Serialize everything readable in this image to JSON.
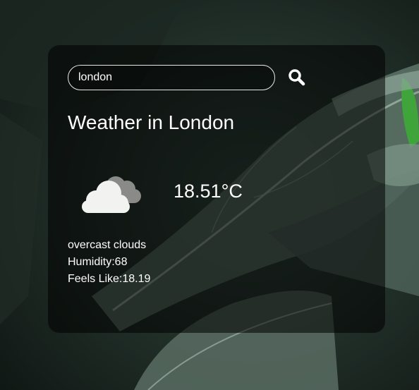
{
  "search": {
    "value": "london",
    "button_icon": "search-icon"
  },
  "weather": {
    "title": "Weather in London",
    "icon": "overcast-cloud-icon",
    "temperature": "18.51°C",
    "description": "overcast clouds",
    "humidity": "Humidity:68",
    "feels_like": "Feels Like:18.19"
  },
  "colors": {
    "card_background": "#000000",
    "text": "#ffffff",
    "input_border": "#e8e8e8",
    "cloud_front": "#f2f2f0",
    "cloud_back": "#8a8a88"
  }
}
